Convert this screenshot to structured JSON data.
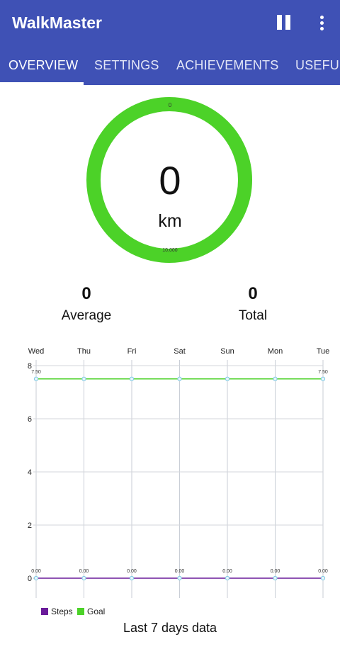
{
  "app": {
    "title": "WalkMaster"
  },
  "toolbar": {
    "pause_icon": "pause-icon",
    "more_icon": "more-vert-icon"
  },
  "tabs": [
    {
      "label": "OVERVIEW",
      "selected": true
    },
    {
      "label": "SETTINGS",
      "selected": false
    },
    {
      "label": "ACHIEVEMENTS",
      "selected": false
    },
    {
      "label": "USEFUL",
      "selected": false
    }
  ],
  "progress": {
    "value": "0",
    "unit": "km",
    "top_label": "0",
    "bottom_label": "10,000",
    "ring_color": "#4cd228"
  },
  "stats": {
    "average": {
      "value": "0",
      "label": "Average"
    },
    "total": {
      "value": "0",
      "label": "Total"
    }
  },
  "chart_data": {
    "type": "line",
    "x": [
      "Wed",
      "Thu",
      "Fri",
      "Sat",
      "Sun",
      "Mon",
      "Tue"
    ],
    "ylim": [
      0,
      8
    ],
    "yticks": [
      0,
      2,
      4,
      6,
      8
    ],
    "series": [
      {
        "name": "Steps",
        "values": [
          0,
          0,
          0,
          0,
          0,
          0,
          0
        ],
        "point_labels": [
          "0.00",
          "0.00",
          "0.00",
          "0.00",
          "0.00",
          "0.00",
          "0.00"
        ],
        "color": "#6a1b9a"
      },
      {
        "name": "Goal",
        "values": [
          7.5,
          7.5,
          7.5,
          7.5,
          7.5,
          7.5,
          7.5
        ],
        "point_labels": [
          "7.50",
          "",
          "",
          "",
          "",
          "",
          "7.50"
        ],
        "color": "#4cd228"
      }
    ],
    "grid": true,
    "legend": "bottom-left",
    "caption": "Last 7 days data"
  },
  "colors": {
    "appbar": "#3f51b5",
    "goal": "#4cd228",
    "steps": "#6a1b9a"
  }
}
